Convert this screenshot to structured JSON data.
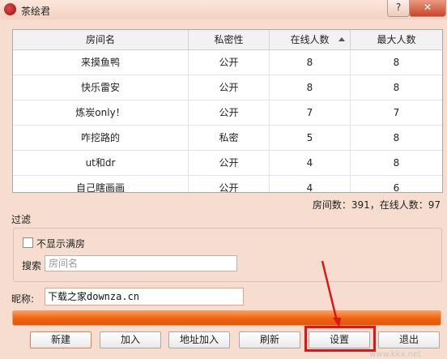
{
  "window": {
    "title": "茶绘君",
    "help_label": "?",
    "close_label": "✕"
  },
  "table": {
    "headers": [
      "房间名",
      "私密性",
      "在线人数",
      "最大人数"
    ],
    "rows": [
      [
        "来摸鱼鸭",
        "公开",
        "8",
        "8"
      ],
      [
        "快乐雷安",
        "公开",
        "8",
        "8"
      ],
      [
        "炼炭only！",
        "公开",
        "7",
        "7"
      ],
      [
        "咋挖路的",
        "私密",
        "5",
        "8"
      ],
      [
        "ut和dr",
        "公开",
        "4",
        "8"
      ],
      [
        "自己瞎画画",
        "公开",
        "4",
        "6"
      ]
    ],
    "sorted_column": "在线人数"
  },
  "stats": {
    "text": "房间数：391，在线人数：97"
  },
  "filter": {
    "label": "过滤",
    "hide_full_label": "不显示满房",
    "hide_full_checked": false,
    "search_label": "搜索",
    "search_placeholder": "房间名"
  },
  "nickname": {
    "label": "昵称:",
    "value": "下载之家downza.cn"
  },
  "progress": {
    "fraction": 1.0,
    "color": "#f0620f"
  },
  "buttons": {
    "new": "新建",
    "join": "加入",
    "address_join": "地址加入",
    "refresh": "刷新",
    "settings": "设置",
    "exit": "退出"
  },
  "watermark": "www.kkx.net",
  "colors": {
    "accent": "#f0620f",
    "highlight": "#e11414",
    "titlebar": "#f3d2c2"
  },
  "icons": {
    "app": "red-ball-icon",
    "sort": "sort-ascending-icon"
  }
}
